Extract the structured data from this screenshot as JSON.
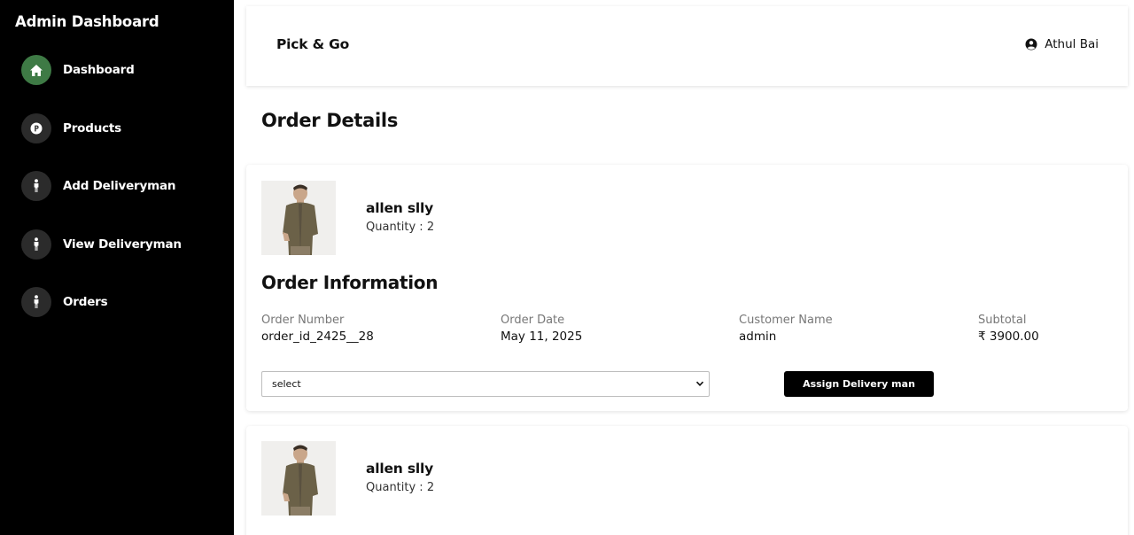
{
  "sidebar": {
    "title": "Admin Dashboard",
    "items": [
      {
        "label": "Dashboard",
        "icon": "home-icon",
        "active": true
      },
      {
        "label": "Products",
        "icon": "product-p-icon",
        "active": false
      },
      {
        "label": "Add Deliveryman",
        "icon": "person-icon",
        "active": false
      },
      {
        "label": "View Deliveryman",
        "icon": "person-icon",
        "active": false
      },
      {
        "label": "Orders",
        "icon": "person-icon",
        "active": false
      }
    ]
  },
  "header": {
    "brand": "Pick & Go",
    "user_name": "Athul Bai",
    "user_icon": "user-circle-icon"
  },
  "page": {
    "title": "Order Details"
  },
  "orders": [
    {
      "product": {
        "name": "allen slly",
        "quantity": "Quantity : 2"
      },
      "info_title": "Order Information",
      "fields": [
        {
          "label": "Order Number",
          "value": "order_id_2425__28"
        },
        {
          "label": "Order Date",
          "value": "May 11, 2025"
        },
        {
          "label": "Customer Name",
          "value": "admin"
        },
        {
          "label": "Subtotal",
          "value": "₹ 3900.00"
        }
      ],
      "select": {
        "value": "select"
      },
      "assign_button": "Assign Delivery man"
    },
    {
      "product": {
        "name": "allen slly",
        "quantity": "Quantity : 2"
      }
    }
  ],
  "colors": {
    "sidebar_bg": "#000000",
    "active_icon_bg": "#3e7a45",
    "icon_bg": "#2b2b2b",
    "button_bg": "#000000"
  }
}
